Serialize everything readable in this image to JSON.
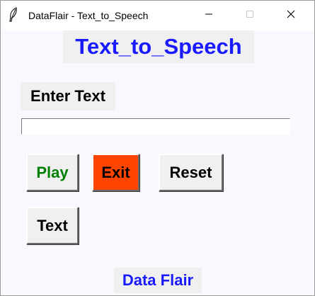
{
  "window": {
    "title": "DataFlair - Text_to_Speech",
    "app_icon": "feather-icon",
    "controls": {
      "minimize_icon": "minimize-icon",
      "maximize_icon": "maximize-icon",
      "close_icon": "close-icon"
    }
  },
  "main": {
    "heading": "Text_to_Speech",
    "input_label": "Enter Text",
    "input_value": "",
    "buttons": {
      "play": "Play",
      "exit": "Exit",
      "reset": "Reset",
      "text": "Text"
    },
    "footer": "Data Flair"
  },
  "colors": {
    "heading": "#1a1aff",
    "play_text": "#008000",
    "exit_bg": "#ff4500",
    "window_bg": "#f8f8fe",
    "widget_bg": "#f0f0f0"
  }
}
